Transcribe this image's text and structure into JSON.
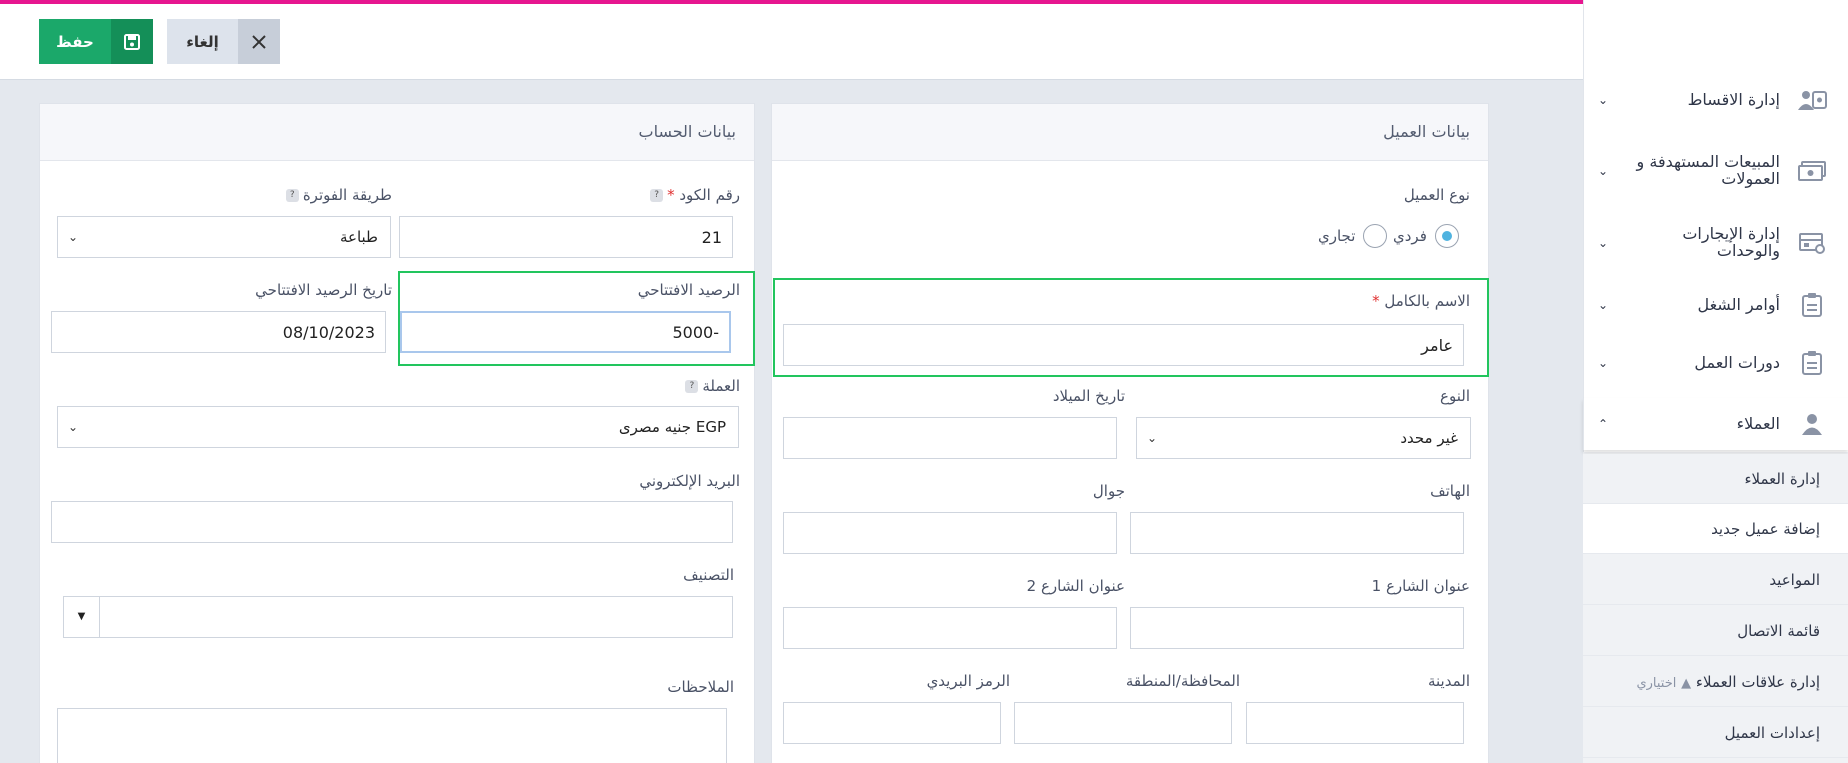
{
  "toolbar": {
    "save_label": "حفظ",
    "cancel_label": "إلغاء"
  },
  "client_panel": {
    "title": "بيانات العميل",
    "client_type_label": "نوع العميل",
    "radio_individual": "فردي",
    "radio_commercial": "تجاري",
    "full_name_label": "الاسم بالكامل",
    "full_name_value": "عامر",
    "gender_label": "النوع",
    "gender_value": "غير محدد",
    "birthdate_label": "تاريخ الميلاد",
    "phone_label": "الهاتف",
    "mobile_label": "جوال",
    "street1_label": "عنوان الشارع 1",
    "street2_label": "عنوان الشارع 2",
    "city_label": "المدينة",
    "region_label": "المحافظة/المنطقة",
    "postal_label": "الرمز البريدي"
  },
  "account_panel": {
    "title": "بيانات الحساب",
    "code_label": "رقم الكود",
    "code_value": "21",
    "invoice_method_label": "طريقة الفوترة",
    "invoice_method_value": "طباعة",
    "opening_balance_label": "الرصيد الافتتاحي",
    "opening_balance_value": "-5000",
    "opening_date_label": "تاريخ الرصيد الافتتاحي",
    "opening_date_value": "08/10/2023",
    "currency_label": "العملة",
    "currency_value": "EGP جنيه مصرى",
    "email_label": "البريد الإلكتروني",
    "category_label": "التصنيف",
    "notes_label": "الملاحظات"
  },
  "sidebar": {
    "items": [
      {
        "label": "إدارة الاقساط",
        "icon": "installments-icon"
      },
      {
        "label": "المبيعات المستهدفة و العمولات",
        "icon": "money-icon"
      },
      {
        "label": "إدارة الإيجارات والوحدات",
        "icon": "rentals-icon"
      },
      {
        "label": "أوامر الشغل",
        "icon": "clipboard-icon"
      },
      {
        "label": "دورات العمل",
        "icon": "clipboard-icon"
      },
      {
        "label": "العملاء",
        "icon": "users-icon"
      }
    ],
    "sub_items": [
      "إدارة العملاء",
      "إضافة عميل جديد",
      "المواعيد",
      "قائمة الاتصال",
      "إدارة علاقات العملاء",
      "إعدادات العميل"
    ],
    "optional_label": "اختياري"
  },
  "colors": {
    "accent": "#e6168f",
    "save": "#1ba86a",
    "highlight": "#22c55e"
  }
}
